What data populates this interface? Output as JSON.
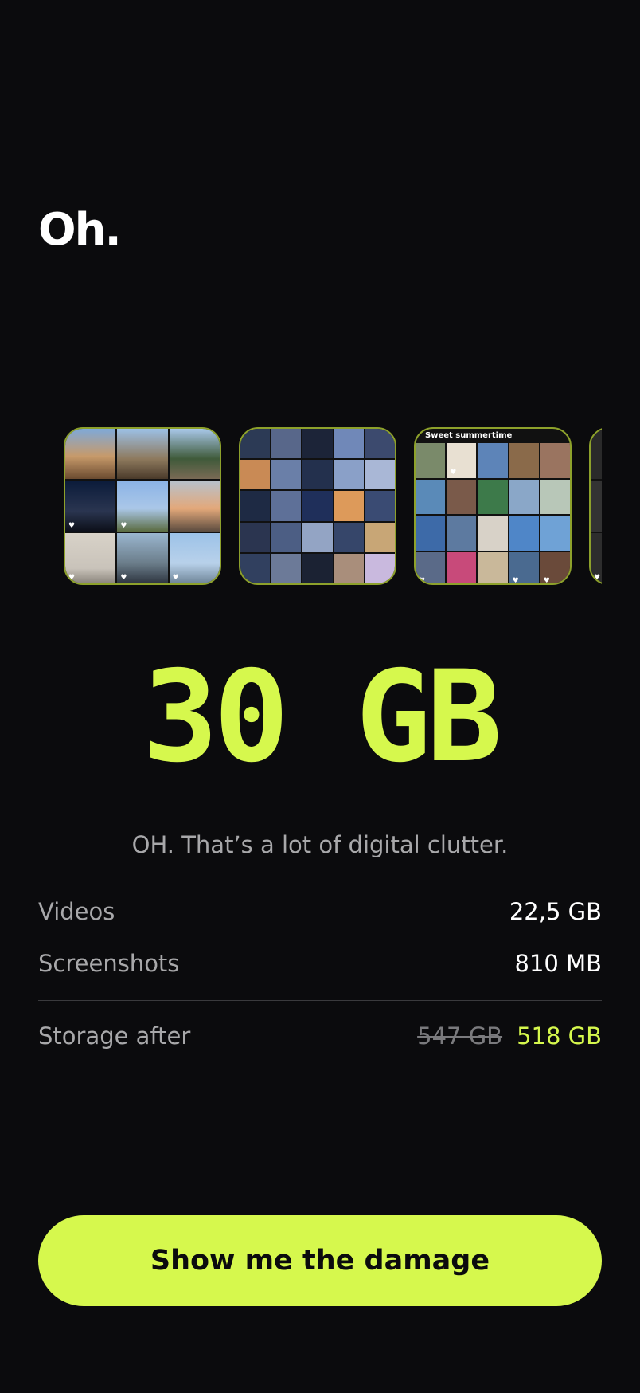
{
  "header": {
    "title": "Oh."
  },
  "albums": [
    {
      "label": "",
      "layout": "g3",
      "tiles": [
        {
          "c": "linear-gradient(180deg,#7fa9d8 0%,#c79a6a 55%,#6b4b30 100%)",
          "h": false
        },
        {
          "c": "linear-gradient(180deg,#9cc0e6 0%,#8e7a5e 60%,#4a3a2a 100%)",
          "h": false
        },
        {
          "c": "linear-gradient(180deg,#a9c8ea 0%,#3f5a3a 60%,#7a6a55 100%)",
          "h": false
        },
        {
          "c": "linear-gradient(180deg,#0b1b3a 0%,#2a3550 60%,#0c0f18 100%)",
          "h": true
        },
        {
          "c": "linear-gradient(180deg,#8bb3e6 0%,#aac7e8 55%,#5a6b40 100%)",
          "h": true
        },
        {
          "c": "linear-gradient(180deg,#b7c2cc 0%,#e3a87a 55%,#5b4b3f 100%)",
          "h": false
        },
        {
          "c": "linear-gradient(180deg,#d8d2c8 0%,#c9c3ba 70%,#8b857c 100%)",
          "h": true
        },
        {
          "c": "linear-gradient(180deg,#9ab6cf 0%,#6b7d8a 60%,#2e3540 100%)",
          "h": true
        },
        {
          "c": "linear-gradient(180deg,#9cc2e8 0%,#b8d1ea 60%,#6f8598 100%)",
          "h": true
        }
      ]
    },
    {
      "label": "",
      "layout": "g5",
      "tiles": [
        {
          "c": "#2c3a55",
          "h": false
        },
        {
          "c": "#58678a",
          "h": false
        },
        {
          "c": "#1c2438",
          "h": false
        },
        {
          "c": "#7088b8",
          "h": false
        },
        {
          "c": "#3c4a6e",
          "h": false
        },
        {
          "c": "#c98a55",
          "h": false
        },
        {
          "c": "#6a7fa8",
          "h": false
        },
        {
          "c": "#23304d",
          "h": false
        },
        {
          "c": "#8aa0c8",
          "h": false
        },
        {
          "c": "#a9b7d6",
          "h": false
        },
        {
          "c": "#1e2a44",
          "h": false
        },
        {
          "c": "#5e7098",
          "h": false
        },
        {
          "c": "#1f2f5a",
          "h": false
        },
        {
          "c": "#dd9a5a",
          "h": false
        },
        {
          "c": "#3a4b73",
          "h": false
        },
        {
          "c": "#2b3550",
          "h": false
        },
        {
          "c": "#4c5e84",
          "h": false
        },
        {
          "c": "#93a4c4",
          "h": false
        },
        {
          "c": "#36466a",
          "h": false
        },
        {
          "c": "#c8a676",
          "h": false
        },
        {
          "c": "#31405f",
          "h": false
        },
        {
          "c": "#6c7a98",
          "h": false
        },
        {
          "c": "#1b2233",
          "h": false
        },
        {
          "c": "#a98e7b",
          "h": false
        },
        {
          "c": "#c9b9de",
          "h": false
        }
      ]
    },
    {
      "label": "Sweet summertime",
      "layout": "g5b",
      "tiles": [
        {
          "c": "#7a8a6a",
          "h": false
        },
        {
          "c": "#e8e0d2",
          "h": true
        },
        {
          "c": "#5d84b8",
          "h": false
        },
        {
          "c": "#8a6a4a",
          "h": false
        },
        {
          "c": "#9a7460",
          "h": false
        },
        {
          "c": "#5a8ab8",
          "h": false
        },
        {
          "c": "#7a5a4a",
          "h": false
        },
        {
          "c": "#3d7a4a",
          "h": false
        },
        {
          "c": "#8aa7c8",
          "h": false
        },
        {
          "c": "#b8c7b8",
          "h": false
        },
        {
          "c": "#3d6aa8",
          "h": false
        },
        {
          "c": "#5d7aa0",
          "h": false
        },
        {
          "c": "#d8d2c8",
          "h": false
        },
        {
          "c": "#4f86c8",
          "h": false
        },
        {
          "c": "#6fa2d6",
          "h": false
        },
        {
          "c": "#5a6a88",
          "h": true
        },
        {
          "c": "#c84a7a",
          "h": false
        },
        {
          "c": "#c9b89a",
          "h": false
        },
        {
          "c": "#4a6a90",
          "h": true
        },
        {
          "c": "#6a4a3a",
          "h": true
        }
      ]
    },
    {
      "label": "",
      "layout": "g3",
      "tiles": [
        {
          "c": "#2a2a2a",
          "h": false
        },
        {
          "c": "#3a3a3a",
          "h": false
        },
        {
          "c": "#222",
          "h": false
        },
        {
          "c": "#333",
          "h": false
        },
        {
          "c": "#2b2b2b",
          "h": false
        },
        {
          "c": "#1f1f1f",
          "h": false
        },
        {
          "c": "#2d2d2d",
          "h": true
        },
        {
          "c": "#262626",
          "h": false
        },
        {
          "c": "#303030",
          "h": false
        }
      ]
    }
  ],
  "summary": {
    "size": "30 GB",
    "subtitle": "OH. That’s a lot of digital clutter."
  },
  "breakdown": {
    "videos_label": "Videos",
    "videos_value": "22,5 GB",
    "screenshots_label": "Screenshots",
    "screenshots_value": "810 MB",
    "storage_label": "Storage after",
    "storage_before": "547 GB",
    "storage_after": "518 GB"
  },
  "cta": {
    "label": "Show me the damage"
  },
  "colors": {
    "accent": "#d6f84d",
    "background": "#0b0b0d",
    "muted": "#a8a8aa"
  }
}
